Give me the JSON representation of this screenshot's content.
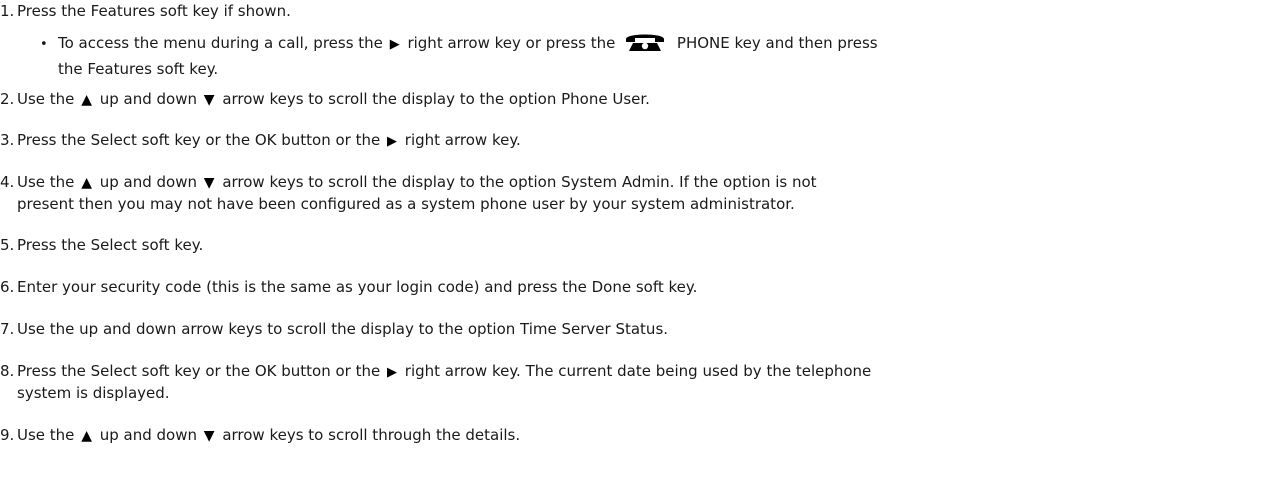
{
  "steps": [
    {
      "number": "1.",
      "text_a": "Press the Features soft key if shown.",
      "sub": {
        "bullet": "•",
        "text_a": "To access the menu during a call, press the ",
        "icon_right": "right-arrow-icon",
        "text_b": " right arrow key or press the ",
        "icon_phone": "phone-key-icon",
        "text_c": " PHONE key and then press",
        "text_d": "the Features soft key."
      }
    },
    {
      "number": "2.",
      "text_a": "Use the ",
      "text_b": " up and down ",
      "text_c": " arrow keys to scroll the display to the option Phone User."
    },
    {
      "number": "3.",
      "text_a": "Press the Select soft key or the OK button or the ",
      "text_b": " right arrow key."
    },
    {
      "number": "4.",
      "text_a": "Use the ",
      "text_b": " up and down ",
      "text_c": " arrow keys to scroll the display to the option System Admin. If the option is not",
      "text_d": "present then you may not have been configured as a system phone user by your system administrator."
    },
    {
      "number": "5.",
      "text_a": "Press the Select soft key."
    },
    {
      "number": "6.",
      "text_a": "Enter your security code (this is the same as your login code) and press the Done soft key."
    },
    {
      "number": "7.",
      "text_a": "Use the up and down arrow keys to scroll the display to the option Time Server Status."
    },
    {
      "number": "8.",
      "text_a": "Press the Select soft key or the OK button or the ",
      "text_b": " right arrow key. The current date being used by the telephone",
      "text_c": "system is displayed."
    },
    {
      "number": "9.",
      "text_a": "Use the ",
      "text_b": " up and down ",
      "text_c": " arrow keys to scroll through the details."
    }
  ],
  "icons": {
    "up": "up-arrow-icon",
    "down": "down-arrow-icon",
    "right": "right-arrow-icon",
    "phone": "phone-key-icon"
  }
}
